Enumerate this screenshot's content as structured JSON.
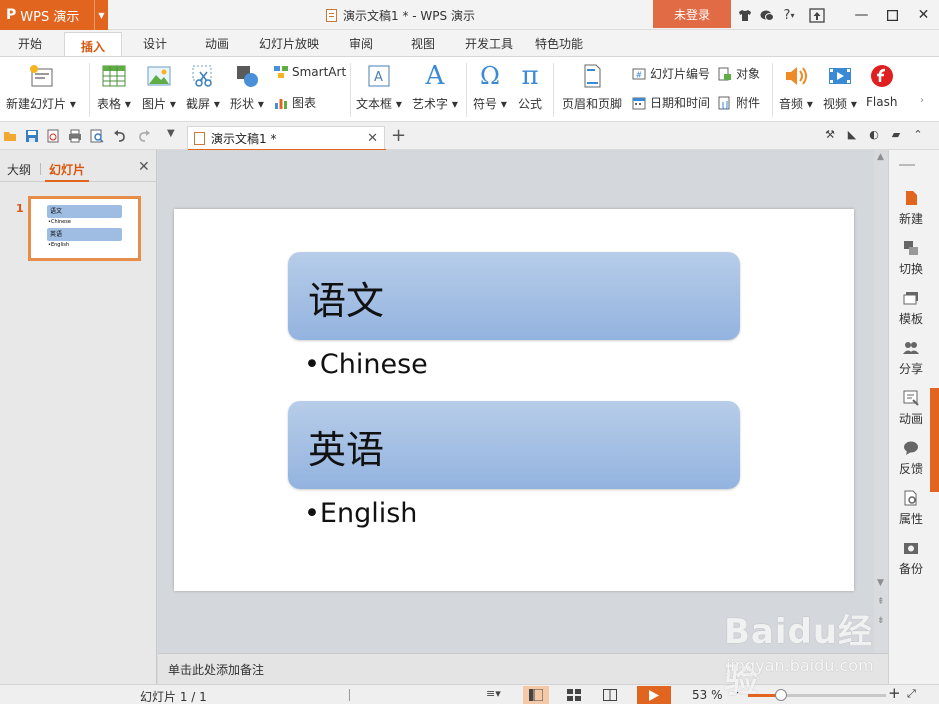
{
  "app": {
    "logo": "P",
    "name": "WPS 演示",
    "window_title": "演示文稿1 * - WPS 演示",
    "login_label": "未登录",
    "title_icons": [
      "shirt-icon",
      "chat-icon",
      "help-icon",
      "upload-icon"
    ],
    "help_glyph": "?"
  },
  "menu": {
    "tabs": [
      "开始",
      "插入",
      "设计",
      "动画",
      "幻灯片放映",
      "审阅",
      "视图",
      "开发工具",
      "特色功能"
    ],
    "active": "插入"
  },
  "ribbon": {
    "new_slide": "新建幻灯片",
    "table": "表格",
    "picture": "图片",
    "screenshot": "截屏",
    "shape": "形状",
    "smartart": "SmartArt",
    "chart": "图表",
    "textbox": "文本框",
    "wordart": "艺术字",
    "symbol": "符号",
    "formula": "公式",
    "header_footer": "页眉和页脚",
    "slide_number": "幻灯片编号",
    "datetime": "日期和时间",
    "object": "对象",
    "attachment": "附件",
    "audio": "音频",
    "video": "视频",
    "flash": "Flash",
    "omega_glyph": "Ω",
    "pi_glyph": "π",
    "wordart_glyph": "A"
  },
  "doc_tab": {
    "name": "演示文稿1 *"
  },
  "left_panel": {
    "tab_outline": "大纲",
    "tab_slides": "幻灯片",
    "thumb_number": "1"
  },
  "slide": {
    "box1_title": "语文",
    "bullet1": "•Chinese",
    "box2_title": "英语",
    "bullet2": "•English"
  },
  "notes": {
    "placeholder": "单击此处添加备注"
  },
  "right_panel": {
    "items": [
      "新建",
      "切换",
      "模板",
      "分享",
      "动画",
      "反馈",
      "属性",
      "备份"
    ]
  },
  "status": {
    "slide_info": "幻灯片 1 / 1",
    "zoom": "53 %",
    "zoom_percent": 53
  },
  "watermark": {
    "logo": "Baidu经验",
    "url": "jingyan.baidu.com"
  },
  "colors": {
    "accent": "#e1651f",
    "shape_top": "#b7cde9",
    "shape_bottom": "#93b3df"
  }
}
